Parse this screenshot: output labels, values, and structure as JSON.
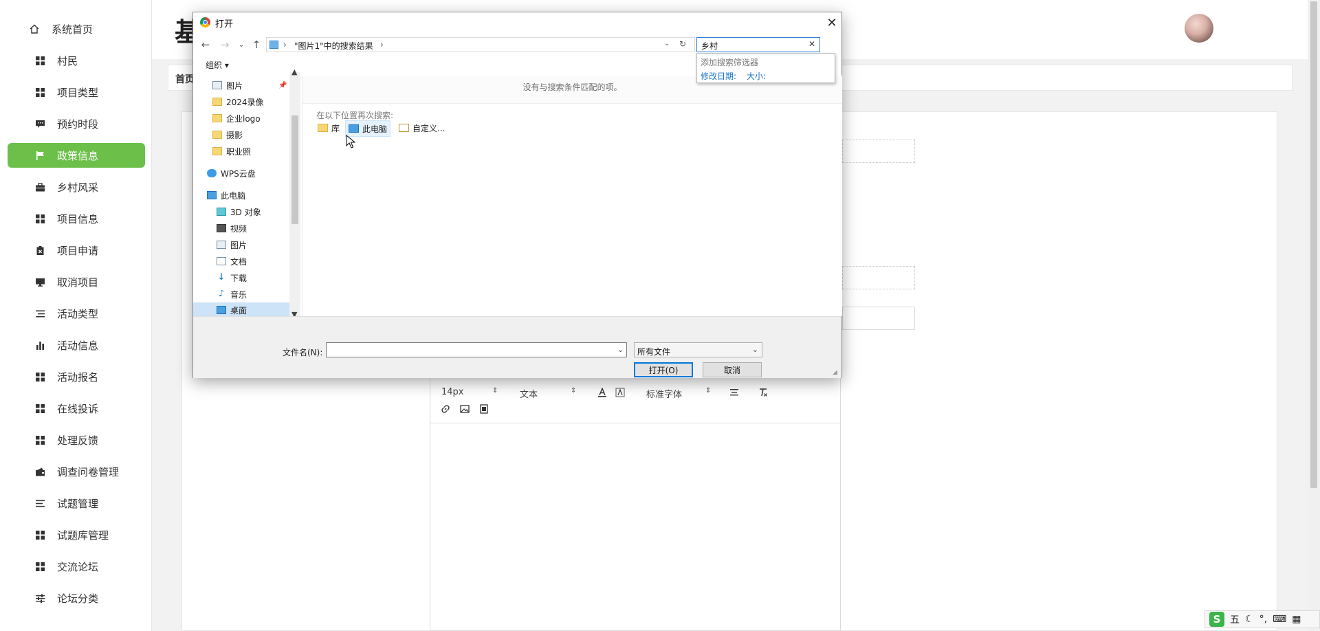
{
  "sidebar": {
    "home": "系统首页",
    "items": [
      "村民",
      "项目类型",
      "预约时段",
      "政策信息",
      "乡村风采",
      "项目信息",
      "项目申请",
      "取消项目",
      "活动类型",
      "活动信息",
      "活动报名",
      "在线投诉",
      "处理反馈",
      "调查问卷管理",
      "试题管理",
      "试题库管理",
      "交流论坛",
      "论坛分类"
    ],
    "active": "政策信息"
  },
  "page": {
    "title_char": "基",
    "breadcrumb_home": "首页"
  },
  "editor": {
    "font_size": "14px",
    "block_type": "文本",
    "font_family": "标准字体"
  },
  "dialog": {
    "title": "打开",
    "address": "\"图片1\"中的搜索结果",
    "search_value": "乡村",
    "suggest_title": "添加搜索筛选器",
    "suggest_date": "修改日期:",
    "suggest_size": "大小:",
    "organize": "组织",
    "tree": [
      "图片",
      "2024录像",
      "企业logo",
      "摄影",
      "职业照",
      "WPS云盘",
      "此电脑",
      "3D 对象",
      "视频",
      "图片",
      "文档",
      "下载",
      "音乐",
      "桌面"
    ],
    "no_match": "没有与搜索条件匹配的项。",
    "search_again": "在以下位置再次搜索:",
    "again_items": [
      "库",
      "此电脑",
      "自定义..."
    ],
    "filename_label": "文件名(N):",
    "filename_value": "",
    "filetype": "所有文件",
    "open_button": "打开(O)",
    "cancel_button": "取消"
  },
  "ime": {
    "logo": "S",
    "mode": "五"
  },
  "colors": {
    "active_menu": "#6cc04a",
    "dialog_accent": "#0078d7"
  }
}
